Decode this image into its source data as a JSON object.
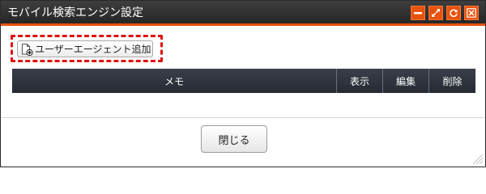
{
  "window": {
    "title": "モバイル検索エンジン設定",
    "controls": [
      {
        "name": "minimize",
        "icon": "minimize-icon"
      },
      {
        "name": "maximize",
        "icon": "expand-arrows-icon"
      },
      {
        "name": "refresh",
        "icon": "refresh-icon"
      },
      {
        "name": "close",
        "icon": "close-icon"
      }
    ],
    "accent_color": "#e8520c"
  },
  "toolbar": {
    "add_user_agent_label": "ユーザーエージェント追加",
    "add_user_agent_icon": "document-add-icon",
    "highlight_color": "#e01010"
  },
  "table": {
    "columns": [
      "メモ",
      "表示",
      "編集",
      "削除"
    ],
    "rows": []
  },
  "footer": {
    "close_label": "閉じる"
  }
}
